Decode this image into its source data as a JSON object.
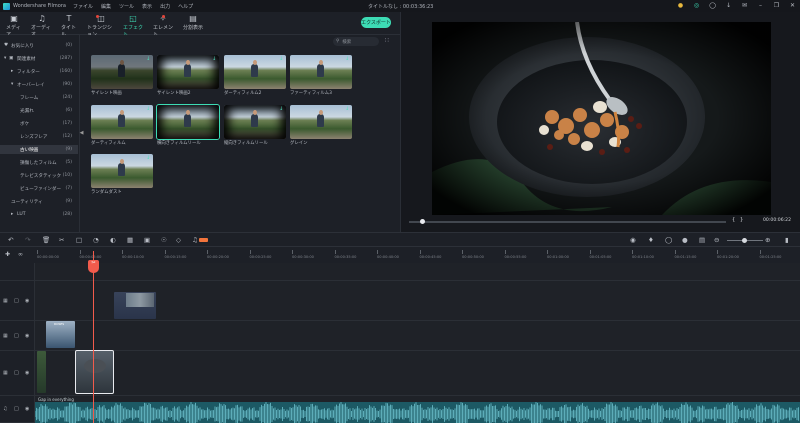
{
  "app": {
    "name": "Wondershare Filmora",
    "menu": [
      "ファイル",
      "編集",
      "ツール",
      "表示",
      "出力",
      "ヘルプ"
    ],
    "doc_title": "タイトルなし : 00:03:36:23"
  },
  "tabs": [
    {
      "label": "メディア",
      "icon": "media-icon"
    },
    {
      "label": "オーディオ",
      "icon": "music-icon"
    },
    {
      "label": "タイトル",
      "icon": "title-icon"
    },
    {
      "label": "トランジション",
      "icon": "transition-icon"
    },
    {
      "label": "エフェクト",
      "icon": "effects-icon"
    },
    {
      "label": "エレメント",
      "icon": "elements-icon"
    },
    {
      "label": "分割表示",
      "icon": "split-screen-icon"
    }
  ],
  "export_label": "エクスポート",
  "sidebar": [
    {
      "label": "お気に入り",
      "count": "(0)"
    },
    {
      "label": "関連素材",
      "count": "(287)"
    },
    {
      "label": "フィルター",
      "count": "(160)"
    },
    {
      "label": "オーバーレイ",
      "count": "(90)"
    },
    {
      "label": "フレーム",
      "count": "(24)"
    },
    {
      "label": "光漏れ",
      "count": "(6)"
    },
    {
      "label": "ボケ",
      "count": "(17)"
    },
    {
      "label": "レンズフレア",
      "count": "(12)"
    },
    {
      "label": "古い映画",
      "count": "(9)"
    },
    {
      "label": "損傷したフィルム",
      "count": "(5)"
    },
    {
      "label": "テレビスタティック",
      "count": "(10)"
    },
    {
      "label": "ビューファインダー",
      "count": "(7)"
    },
    {
      "label": "ユーティリティ",
      "count": "(9)"
    },
    {
      "label": "LUT",
      "count": "(28)"
    }
  ],
  "search_placeholder": "検索",
  "effects": [
    {
      "label": "サイレント映画"
    },
    {
      "label": "サイレント映画2"
    },
    {
      "label": "ダーティフィルム2"
    },
    {
      "label": "ファーティフィルム3"
    },
    {
      "label": "ダーティフィルム"
    },
    {
      "label": "横向きフィルムリール"
    },
    {
      "label": "縦向きフィルムリール"
    },
    {
      "label": "グレイン"
    },
    {
      "label": "ランダムダスト"
    }
  ],
  "preview": {
    "timecode": "00:00:06:22",
    "ratio": "1/2",
    "progress": 0.04
  },
  "ruler": [
    "00:00:00:00",
    "00:00:05:00",
    "00:00:10:00",
    "00:00:15:00",
    "00:00:20:00",
    "00:00:25:00",
    "00:00:30:00",
    "00:00:35:00",
    "00:00:40:00",
    "00:00:45:00",
    "00:00:50:00",
    "00:00:55:00",
    "00:01:00:00",
    "00:01:05:00",
    "00:01:10:00",
    "00:01:15:00",
    "00:01:20:00",
    "00:01:25:00"
  ],
  "tracks": {
    "clip_label_small": "ROSES",
    "audio_label": "Gap in everything"
  },
  "colors": {
    "accent": "#3ddcb5",
    "playhead": "#f25b4c",
    "audio": "#1c5964"
  }
}
